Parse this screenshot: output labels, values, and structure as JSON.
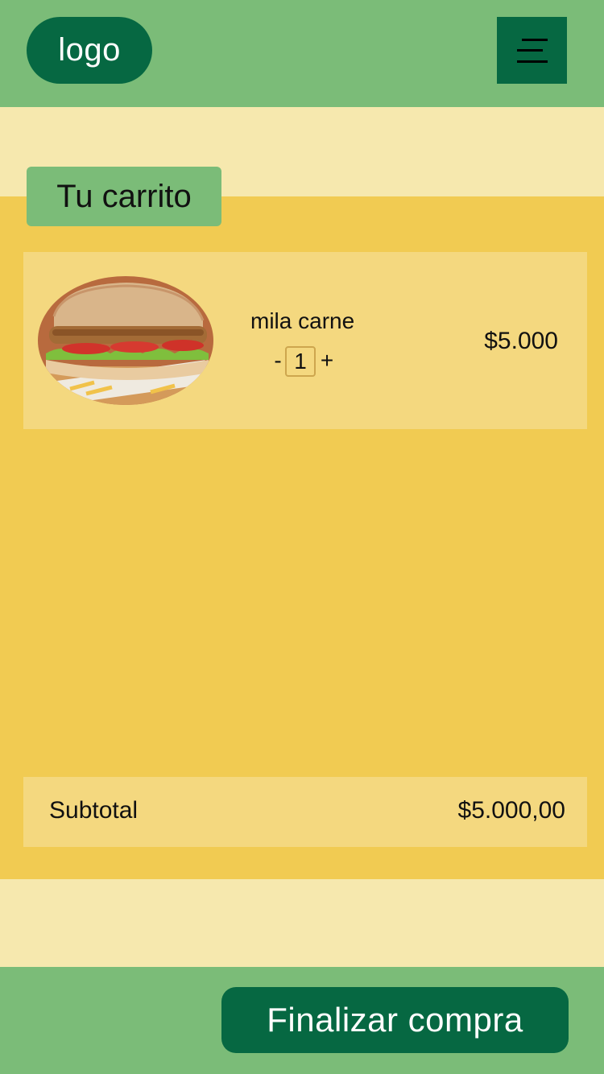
{
  "header": {
    "logo_text": "logo",
    "menu_icon": "hamburger-menu-icon"
  },
  "cart": {
    "title": "Tu carrito",
    "items": [
      {
        "name": "mila carne",
        "image": "sandwich-photo",
        "quantity_minus": "-",
        "quantity": "1",
        "quantity_plus": "+",
        "price": "$5.000"
      }
    ],
    "subtotal_label": "Subtotal",
    "subtotal_value": "$5.000,00"
  },
  "footer": {
    "checkout_label": "Finalizar compra"
  },
  "colors": {
    "header_green": "#7bbc78",
    "dark_green": "#066842",
    "cart_yellow": "#f1cb52",
    "card_yellow": "#f4d87f",
    "background_cream": "#f6e8ae"
  }
}
